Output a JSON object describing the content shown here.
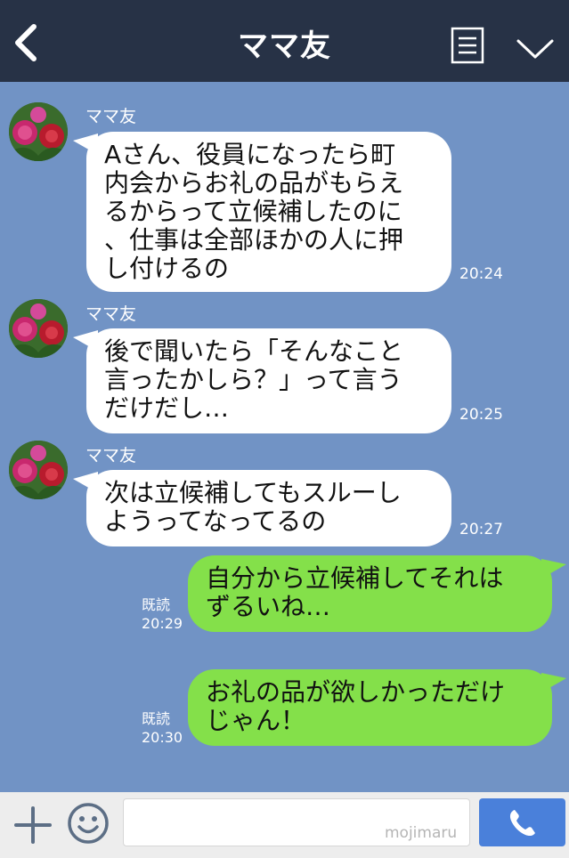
{
  "header": {
    "title": "ママ友",
    "back_icon": "chevron-left-icon",
    "menu_icon": "note-list-icon",
    "expand_icon": "chevron-down-icon"
  },
  "messages": [
    {
      "direction": "incoming",
      "sender": "ママ友",
      "text": "Aさん、役員になったら町\n内会からお礼の品がもらえ\nるからって立候補したのに\n、仕事は全部ほかの人に押\nし付けるの",
      "time": "20:24"
    },
    {
      "direction": "incoming",
      "sender": "ママ友",
      "text": "後で聞いたら「そんなこと\n言ったかしら？」って言う\nだけだし…",
      "time": "20:25"
    },
    {
      "direction": "incoming",
      "sender": "ママ友",
      "text": "次は立候補してもスルーし\nようってなってるの",
      "time": "20:27"
    },
    {
      "direction": "outgoing",
      "read_label": "既読",
      "text": "自分から立候補してそれは\nずるいね…",
      "time": "20:29"
    },
    {
      "direction": "outgoing",
      "read_label": "既読",
      "text": "お礼の品が欲しかっただけ\nじゃん！",
      "time": "20:30"
    }
  ],
  "input": {
    "placeholder": "",
    "watermark": "mojimaru",
    "plus_icon": "plus-icon",
    "sticker_icon": "smiley-icon",
    "call_icon": "phone-icon"
  },
  "colors": {
    "header_bg": "#273246",
    "chat_bg": "#7193c5",
    "incoming_bubble": "#ffffff",
    "outgoing_bubble": "#84e04a",
    "call_button": "#4a80da"
  }
}
